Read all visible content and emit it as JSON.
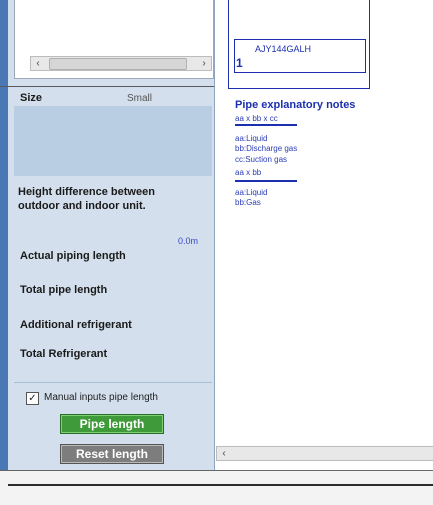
{
  "left_panel": {
    "size_label": "Size",
    "size_value": "Small",
    "height_diff_label_1": "Height difference between",
    "height_diff_label_2": "outdoor and indoor unit.",
    "height_value": "0.0m",
    "actual_piping_label": "Actual piping length",
    "total_pipe_label": "Total pipe length",
    "additional_refrigerant_label": "Additional refrigerant",
    "total_refrigerant_label": "Total Refrigerant",
    "manual_inputs_label": "Manual inputs pipe length",
    "manual_inputs_checked": true,
    "pipe_length_button": "Pipe length",
    "reset_length_button": "Reset length"
  },
  "diagram": {
    "unit_model": "AJY144GALH",
    "unit_number": "1"
  },
  "notes": {
    "title": "Pipe explanatory notes",
    "format1": "aa x bb x cc",
    "f1_a": "aa:Liquid",
    "f1_b": "bb:Discharge gas",
    "f1_c": "cc:Suction gas",
    "format2": "aa x bb",
    "f2_a": "aa:Liquid",
    "f2_b": "bb:Gas"
  },
  "icons": {
    "left_arrow": "‹",
    "right_arrow": "›",
    "check": "✓"
  },
  "colors": {
    "accent_blue": "#1b2fb0",
    "green_button": "#3f9a3a",
    "gray_button": "#7d7d7d"
  }
}
